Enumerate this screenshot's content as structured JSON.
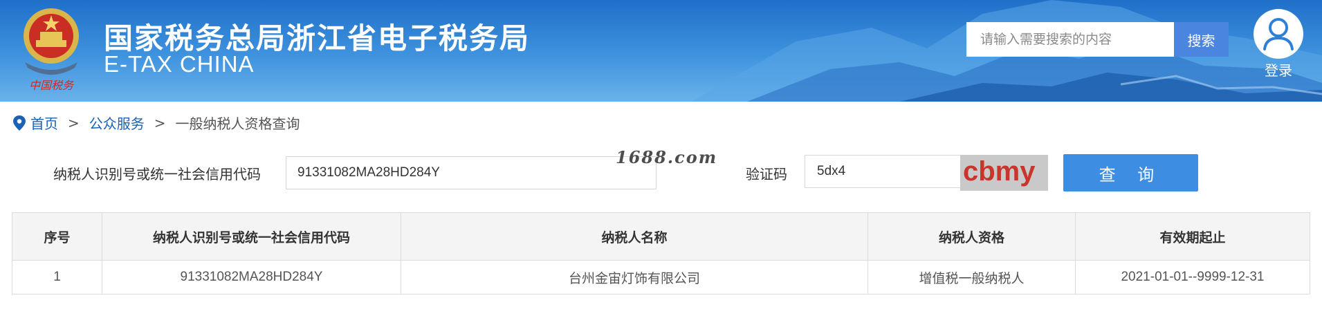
{
  "header": {
    "title_cn": "国家税务总局浙江省电子税务局",
    "title_en": "E-TAX CHINA",
    "emblem_caption": "中国税务",
    "search": {
      "placeholder": "请输入需要搜索的内容",
      "button_label": "搜索"
    },
    "login_label": "登录",
    "colors": {
      "banner": "#2f86d8",
      "search_button": "#4a86e0"
    }
  },
  "breadcrumb": {
    "home": "首页",
    "separator": ">",
    "section": "公众服务",
    "current": "一般纳税人资格查询",
    "icon": "location-pin-icon"
  },
  "query_form": {
    "taxid_label": "纳税人识别号或统一社会信用代码",
    "taxid_value": "91331082MA28HD284Y",
    "captcha_label": "验证码",
    "captcha_value": "5dx4",
    "captcha_image_text": "cbmy",
    "query_button": "查 询",
    "watermark": "1688.com"
  },
  "results_table": {
    "columns": [
      "序号",
      "纳税人识别号或统一社会信用代码",
      "纳税人名称",
      "纳税人资格",
      "有效期起止"
    ],
    "rows": [
      [
        "1",
        "91331082MA28HD284Y",
        "台州金宙灯饰有限公司",
        "增值税一般纳税人",
        "2021-01-01--9999-12-31"
      ]
    ]
  }
}
